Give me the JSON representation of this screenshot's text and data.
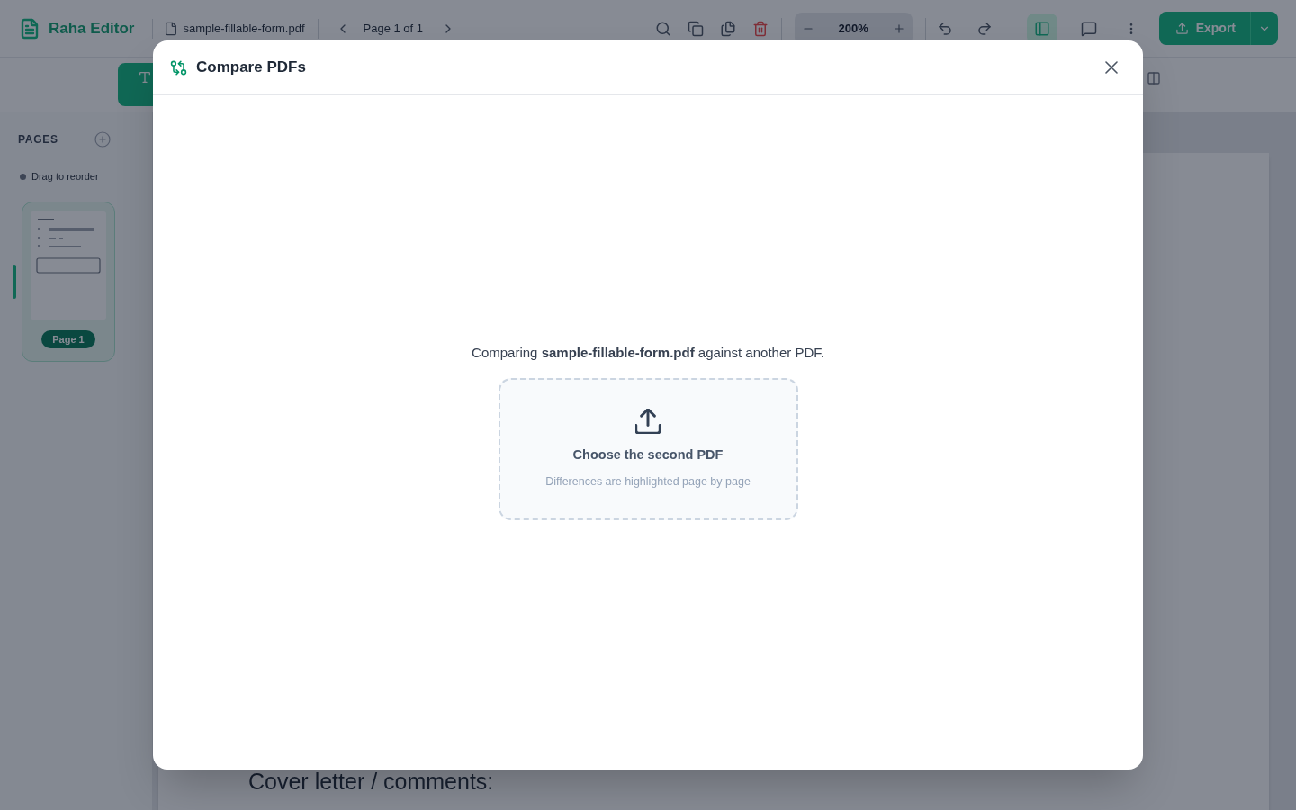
{
  "editor": {
    "app_name": "Raha Editor",
    "file_name": "sample-fillable-form.pdf",
    "page_indicator": "Page 1 of 1",
    "zoom_level": "200%",
    "export_label": "Export"
  },
  "pages_panel": {
    "title": "PAGES",
    "hint": "Drag to reorder",
    "pages": [
      {
        "label": "Page 1",
        "selected": true
      }
    ]
  },
  "document": {
    "heading": "Cover letter / comments:"
  },
  "dialog": {
    "title": "Compare PDFs",
    "intro": "Comparing **sample-fillable-form.pdf** against another PDF.",
    "dropzone": {
      "title": "Choose the second PDF",
      "hint": "Differences are highlighted page by page"
    }
  }
}
